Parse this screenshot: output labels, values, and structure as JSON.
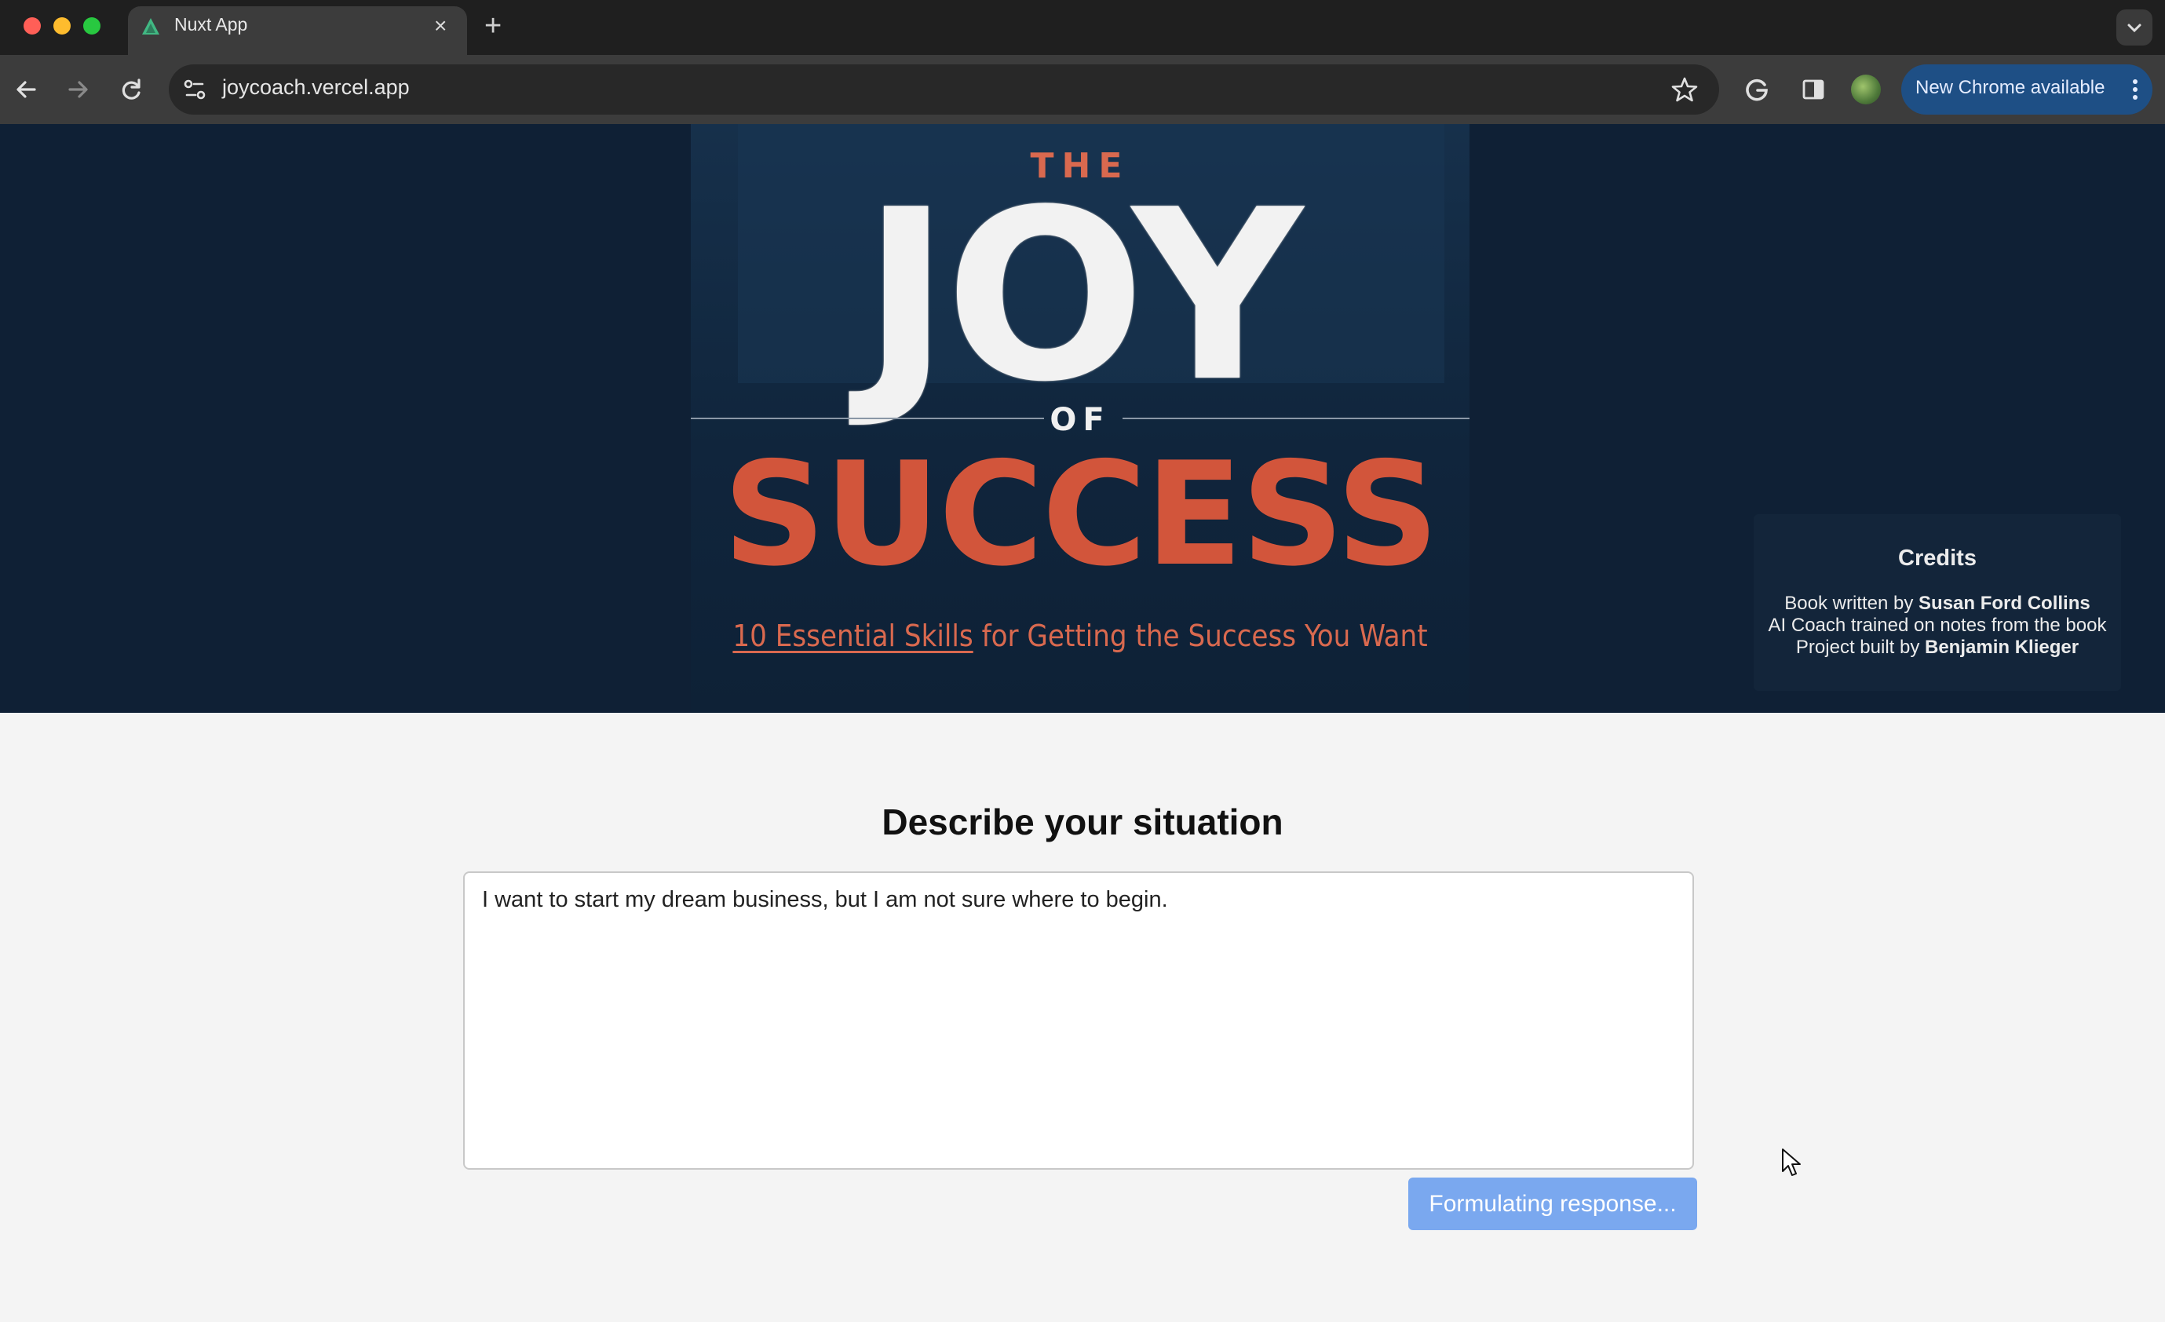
{
  "browser": {
    "tab": {
      "title": "Nuxt App"
    },
    "address_bar": {
      "url": "joycoach.vercel.app"
    },
    "update_button": {
      "label": "New Chrome available"
    },
    "colors": {
      "accent": "#1e4f85"
    }
  },
  "hero": {
    "book_cover": {
      "the": "THE",
      "joy": "JOY",
      "of": "OF",
      "success": "SUCCESS",
      "subtitle_emphasis": "10 Essential Skills",
      "subtitle_rest": " for Getting the Success You Want"
    },
    "credits": {
      "title": "Credits",
      "line1_prefix": "Book written by ",
      "line1_name": "Susan Ford Collins",
      "line2": "AI Coach trained on notes from the book",
      "line3_prefix": "Project built by ",
      "line3_name": "Benjamin Klieger"
    }
  },
  "form": {
    "heading": "Describe your situation",
    "situation_value": "I want to start my dream business, but I am not sure where to begin.",
    "submit_label": "Formulating response..."
  },
  "colors": {
    "hero_background": "#0f2035",
    "success_red": "#d2553b",
    "button_blue": "#7aa8ef"
  }
}
